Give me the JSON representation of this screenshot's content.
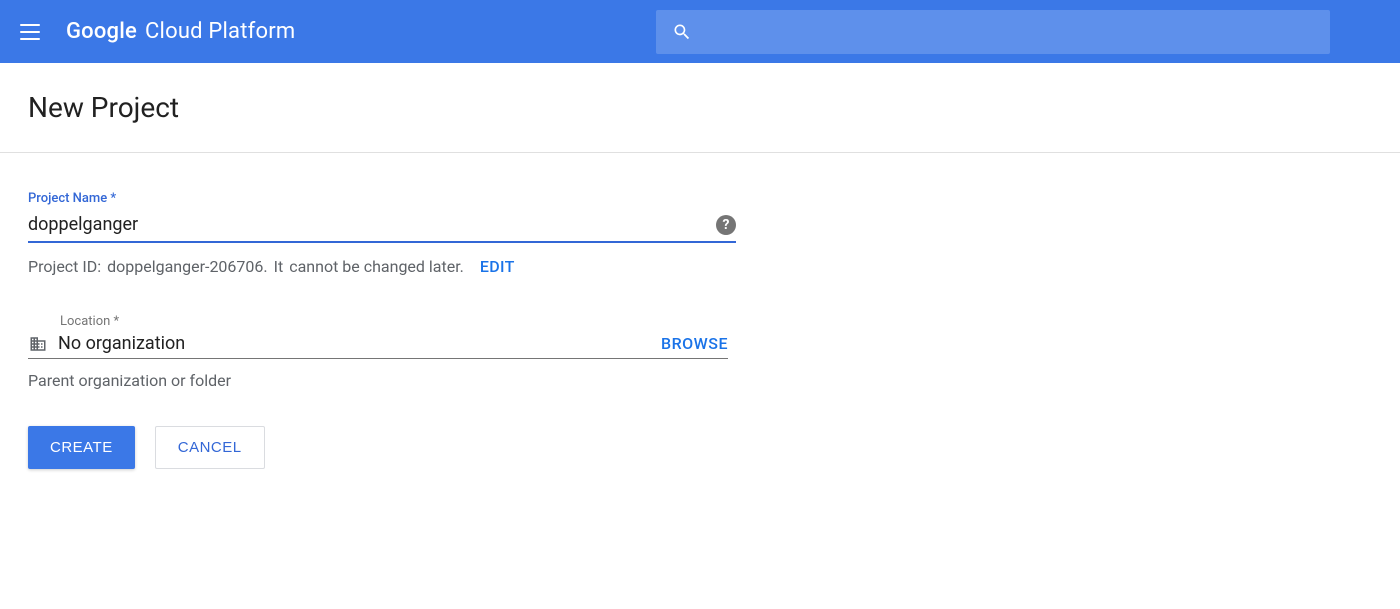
{
  "header": {
    "brand_google": "Google",
    "brand_rest": "Cloud Platform"
  },
  "page": {
    "title": "New Project"
  },
  "form": {
    "project_name": {
      "label": "Project Name *",
      "value": "doppelganger"
    },
    "project_id": {
      "label": "Project ID:",
      "value": "doppelganger-206706.",
      "note_prefix": "It",
      "note_bold": "cannot be changed later.",
      "edit_label": "EDIT"
    },
    "location": {
      "label": "Location *",
      "value": "No organization",
      "browse_label": "BROWSE",
      "helper": "Parent organization or folder"
    },
    "buttons": {
      "create": "CREATE",
      "cancel": "CANCEL"
    }
  }
}
